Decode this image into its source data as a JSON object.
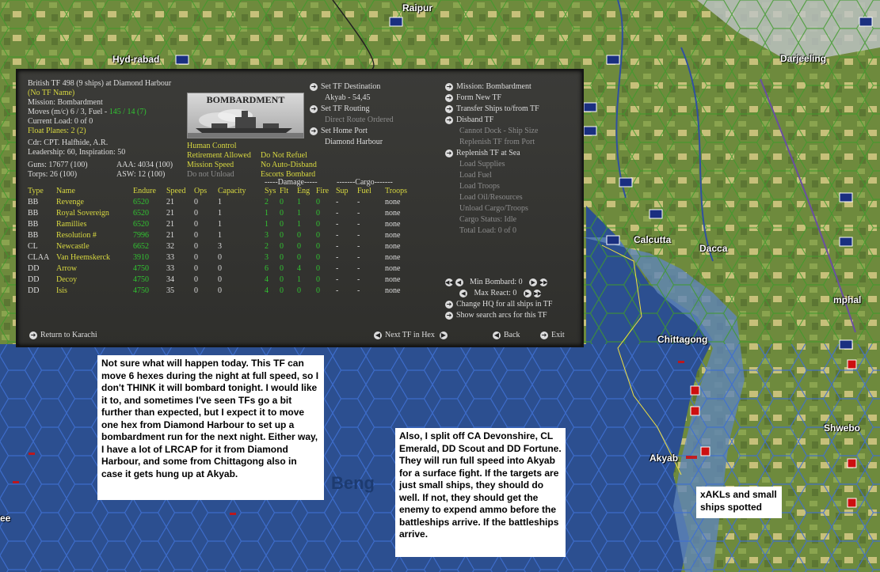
{
  "map": {
    "labels": [
      {
        "name": "map-label-raipur",
        "text": "Raipur"
      },
      {
        "name": "map-label-hyderabad",
        "text": "Hyd-rabad"
      },
      {
        "name": "map-label-darjeeling",
        "text": "Darjeeling"
      },
      {
        "name": "map-label-calcutta",
        "text": "Calcutta"
      },
      {
        "name": "map-label-dacca",
        "text": "Dacca"
      },
      {
        "name": "map-label-imphal",
        "text": "mphal"
      },
      {
        "name": "map-label-chittagong",
        "text": "Chittagong"
      },
      {
        "name": "map-label-shwebo",
        "text": "Shwebo"
      },
      {
        "name": "map-label-akyab",
        "text": "Akyab"
      },
      {
        "name": "map-label-bengal",
        "text": "Beng"
      },
      {
        "name": "map-label-ee",
        "text": "ee"
      }
    ]
  },
  "tf": {
    "title": "British TF 498 (9 ships) at Diamond Harbour",
    "tf_name": "(No TF Name)",
    "mission": "Mission: Bombardment",
    "moves_prefix": "Moves (m/c) 6 / 3, Fuel - ",
    "moves_fuel": "145 / 14 (7)",
    "current_load": "Current Load: 0 of 0",
    "float_planes": "Float Planes: 2 (2)",
    "cdr": "Cdr: CPT. Halfhide, A.R.",
    "leadership": "Leadership: 60, Inspiration: 50",
    "guns": "Guns: 17677 (100)",
    "aaa": "AAA: 4034 (100)",
    "torps": "Torps: 26 (100)",
    "asw": "ASW: 12 (100)",
    "image_label": "BOMBARDMENT",
    "options": {
      "human_control": "Human Control",
      "retirement": "Retirement Allowed",
      "mission_speed": "Mission Speed",
      "do_not_unload": "Do not Unload",
      "do_not_refuel": "Do Not Refuel",
      "no_auto_disband": "No Auto-Disband",
      "escorts_bombard": "Escorts Bombard"
    },
    "nav": {
      "set_destination": "Set TF Destination",
      "destination_value": "Akyab - 54,45",
      "set_routing": "Set TF Routing",
      "direct_route": "Direct Route Ordered",
      "set_home_port": "Set Home Port",
      "home_port_value": "Diamond Harbour"
    },
    "actions": {
      "mission": "Mission: Bombardment",
      "form_new": "Form New TF",
      "transfer": "Transfer Ships to/from TF",
      "disband": "Disband TF",
      "cannot_dock": "Cannot Dock - Ship Size",
      "replenish_port": "Replenish TF from Port",
      "replenish_sea": "Replenish TF at Sea",
      "load_supplies": "Load Supplies",
      "load_fuel": "Load Fuel",
      "load_troops": "Load Troops",
      "load_oil": "Load Oil/Resources",
      "unload_cargo": "Unload Cargo/Troops",
      "cargo_status": "Cargo Status: Idle",
      "total_load": "Total Load: 0 of 0"
    },
    "group_headers": {
      "damage": "-----Damage-----",
      "cargo": "-------Cargo-------"
    },
    "columns": {
      "type": "Type",
      "name": "Name",
      "endure": "Endure",
      "speed": "Speed",
      "ops": "Ops",
      "capacity": "Capacity",
      "sys": "Sys",
      "flt": "Flt",
      "eng": "Eng",
      "fire": "Fire",
      "sup": "Sup",
      "fuel": "Fuel",
      "troops": "Troops"
    },
    "ships": [
      {
        "type": "BB",
        "name": "Revenge",
        "endure": "6520",
        "speed": "21",
        "ops": "0",
        "capacity": "1",
        "sys": "2",
        "flt": "0",
        "eng": "1",
        "fire": "0",
        "sup": "-",
        "fuel": "-",
        "troops": "none"
      },
      {
        "type": "BB",
        "name": "Royal Sovereign",
        "endure": "6520",
        "speed": "21",
        "ops": "0",
        "capacity": "1",
        "sys": "1",
        "flt": "0",
        "eng": "1",
        "fire": "0",
        "sup": "-",
        "fuel": "-",
        "troops": "none"
      },
      {
        "type": "BB",
        "name": "Ramillies",
        "endure": "6520",
        "speed": "21",
        "ops": "0",
        "capacity": "1",
        "sys": "1",
        "flt": "0",
        "eng": "1",
        "fire": "0",
        "sup": "-",
        "fuel": "-",
        "troops": "none"
      },
      {
        "type": "BB",
        "name": "Resolution #",
        "endure": "7996",
        "speed": "21",
        "ops": "0",
        "capacity": "1",
        "sys": "3",
        "flt": "0",
        "eng": "0",
        "fire": "0",
        "sup": "-",
        "fuel": "-",
        "troops": "none"
      },
      {
        "type": "CL",
        "name": "Newcastle",
        "endure": "6652",
        "speed": "32",
        "ops": "0",
        "capacity": "3",
        "sys": "2",
        "flt": "0",
        "eng": "0",
        "fire": "0",
        "sup": "-",
        "fuel": "-",
        "troops": "none"
      },
      {
        "type": "CLAA",
        "name": "Van Heemskerck",
        "endure": "3910",
        "speed": "33",
        "ops": "0",
        "capacity": "0",
        "sys": "3",
        "flt": "0",
        "eng": "0",
        "fire": "0",
        "sup": "-",
        "fuel": "-",
        "troops": "none"
      },
      {
        "type": "DD",
        "name": "Arrow",
        "endure": "4750",
        "speed": "33",
        "ops": "0",
        "capacity": "0",
        "sys": "6",
        "flt": "0",
        "eng": "4",
        "fire": "0",
        "sup": "-",
        "fuel": "-",
        "troops": "none"
      },
      {
        "type": "DD",
        "name": "Decoy",
        "endure": "4750",
        "speed": "34",
        "ops": "0",
        "capacity": "0",
        "sys": "4",
        "flt": "0",
        "eng": "1",
        "fire": "0",
        "sup": "-",
        "fuel": "-",
        "troops": "none"
      },
      {
        "type": "DD",
        "name": "Isis",
        "endure": "4750",
        "speed": "35",
        "ops": "0",
        "capacity": "0",
        "sys": "4",
        "flt": "0",
        "eng": "0",
        "fire": "0",
        "sup": "-",
        "fuel": "-",
        "troops": "none"
      }
    ],
    "min_bombard": "Min Bombard: 0",
    "max_react": "Max React: 0",
    "change_hq": "Change HQ for all ships in TF",
    "show_arcs": "Show search arcs for this TF",
    "return": "Return to Karachi",
    "next_tf": "Next TF in Hex",
    "back": "Back",
    "exit": "Exit"
  },
  "notes": {
    "note1": "Not sure what will happen today.  This TF can move 6 hexes during the night at full speed, so I don't THINK it will bombard tonight.  I would like it to, and sometimes I've seen TFs go a bit further than expected, but I expect it to move one hex from Diamond Harbour to set up a bombardment run for the next night.  Either way, I have a lot of LRCAP for it from Diamond Harbour, and some from Chittagong also in case it gets hung up at Akyab.",
    "note2": "Also, I split off CA Devonshire, CL Emerald, DD Scout and DD Fortune.  They will run full speed into Akyab for a surface fight.  If the targets are just small ships, they should do well.  If not, they should get the enemy to expend ammo before the battleships arrive.  If the battleships arrive.",
    "note3": "xAKLs and small ships spotted"
  },
  "colors": {
    "sea": "#2a4f8c",
    "land": "#6f8a3e",
    "panel": "#363633",
    "hex_sea": "#4a7ad6",
    "hex_land": "#3a8a2a",
    "yellow_text": "#d8d840",
    "green_text": "#31c431"
  }
}
